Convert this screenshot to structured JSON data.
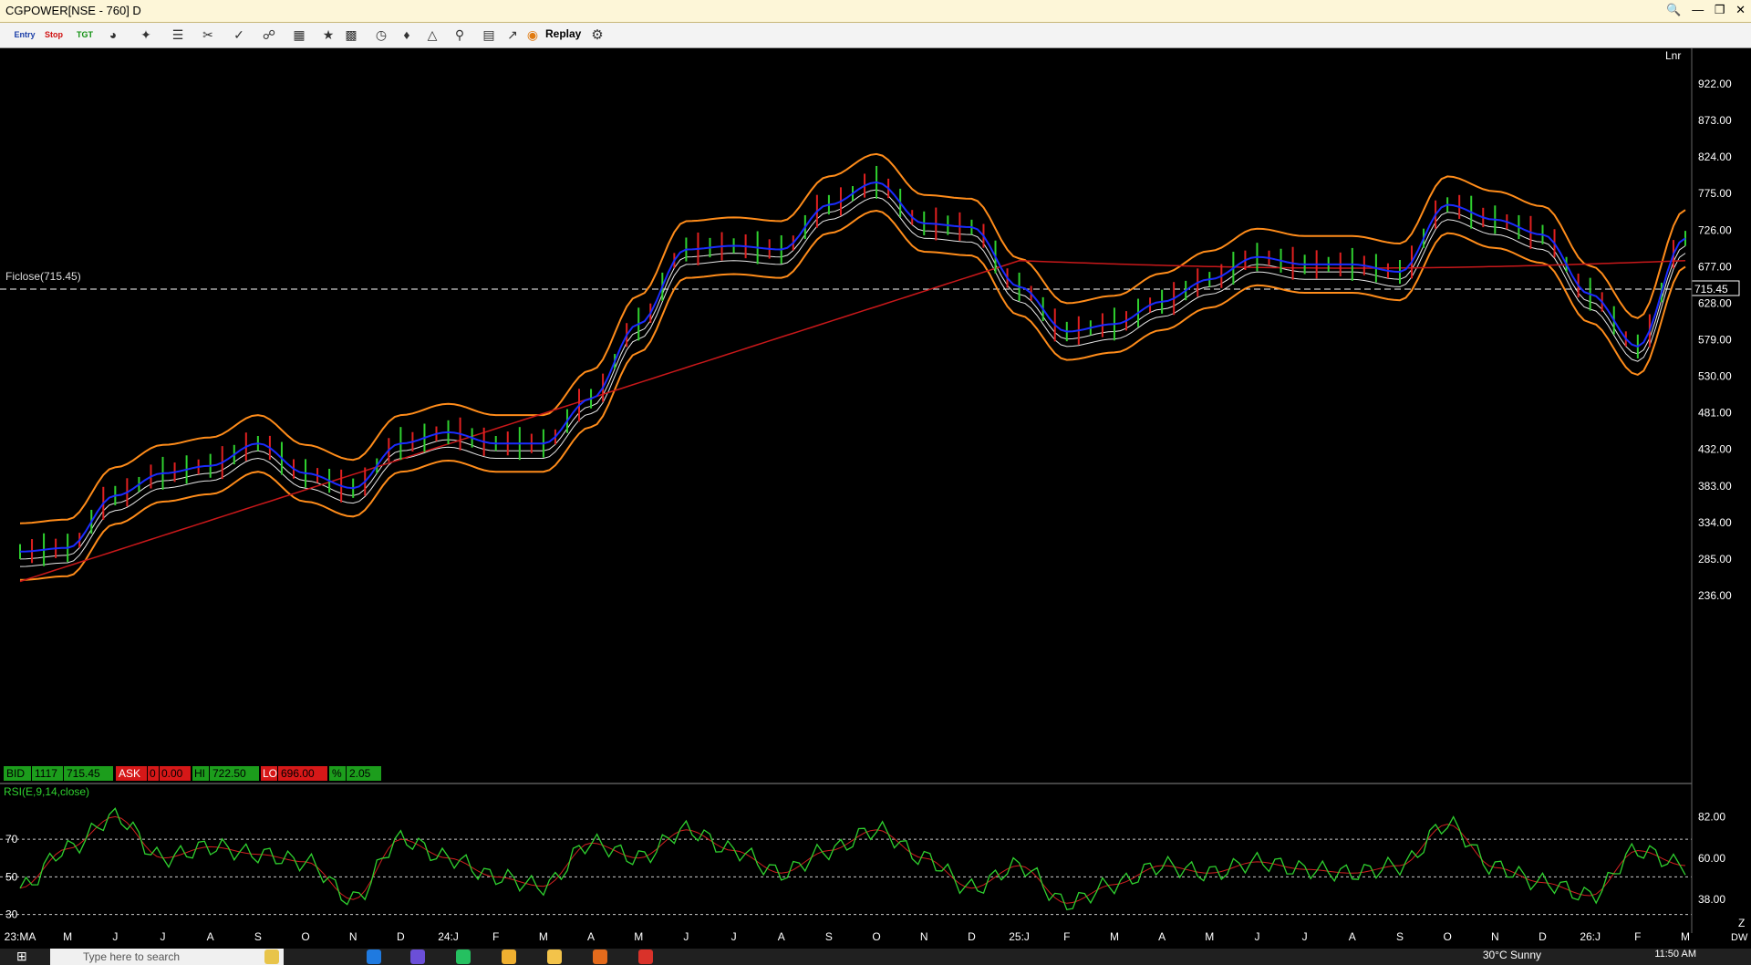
{
  "window": {
    "title": "CGPOWER[NSE - 760] D"
  },
  "toolbar": {
    "entry": "Entry",
    "stop": "Stop",
    "tgt": "TGT",
    "replay": "Replay"
  },
  "chart": {
    "scale_mode": "Lnr",
    "cursor_label": "Ficlose(715.45)",
    "last_price_tag": "715.45",
    "price_ticks": [
      "922.00",
      "873.00",
      "824.00",
      "775.00",
      "726.00",
      "677.00",
      "628.00",
      "579.00",
      "530.00",
      "481.00",
      "432.00",
      "383.00",
      "334.00",
      "285.00",
      "236.00"
    ],
    "quote_bar": {
      "bid_label": "BID",
      "bid_qty": "1117",
      "bid_price": "715.45",
      "ask_label": "ASK",
      "ask_qty": "0",
      "ask_price": "0.00",
      "hi_label": "HI",
      "hi": "722.50",
      "lo_label": "LO",
      "lo": "696.00",
      "pct_label": "%",
      "pct": "2.05"
    },
    "rsi": {
      "label": "RSI(E,9,14,close)",
      "left_levels": [
        "70",
        "50",
        "30"
      ],
      "right_ticks": [
        "82.00",
        "60.00",
        "38.00"
      ]
    },
    "x_axis": [
      "23:MA",
      "M",
      "J",
      "J",
      "A",
      "S",
      "O",
      "N",
      "D",
      "24:J",
      "F",
      "M",
      "A",
      "M",
      "J",
      "J",
      "A",
      "S",
      "O",
      "N",
      "D",
      "25:J",
      "F",
      "M",
      "A",
      "M",
      "J",
      "J",
      "A",
      "S",
      "O",
      "N",
      "D",
      "26:J",
      "F",
      "M"
    ],
    "corner_labels": {
      "z": "Z",
      "dw": "DW"
    },
    "colors": {
      "price_line": "#1a2cff",
      "bands": "#ff8c1a",
      "ma_white": "#e8e8e8",
      "long_ma": "#c8181a",
      "rsi_line": "#2fd12f",
      "rsi_signal": "#d02020",
      "quote_green": "#1c9d1c",
      "quote_red": "#d61818"
    }
  },
  "chart_data": {
    "type": "line",
    "title": "CGPOWER[NSE - 760] D",
    "categories": [
      "23:MA",
      "M",
      "J",
      "J",
      "A",
      "S",
      "O",
      "N",
      "D",
      "24:J",
      "F",
      "M",
      "A",
      "M",
      "J",
      "J",
      "A",
      "S",
      "O",
      "N",
      "D",
      "25:J",
      "F",
      "M",
      "A",
      "M",
      "J",
      "J",
      "A",
      "S",
      "O",
      "N",
      "D",
      "26:J",
      "F",
      "M"
    ],
    "series": [
      {
        "values": [
          295,
          300,
          370,
          400,
          410,
          440,
          400,
          380,
          440,
          455,
          440,
          440,
          500,
          600,
          700,
          705,
          700,
          760,
          790,
          735,
          730,
          650,
          590,
          600,
          630,
          660,
          690,
          680,
          680,
          670,
          760,
          740,
          720,
          640,
          570,
          715
        ]
      }
    ],
    "ylim": [
      236,
      922
    ],
    "rsi_values": [
      44,
      65,
      82,
      60,
      66,
      62,
      58,
      38,
      70,
      60,
      50,
      45,
      68,
      60,
      75,
      64,
      52,
      64,
      75,
      60,
      44,
      56,
      36,
      46,
      56,
      52,
      58,
      54,
      52,
      56,
      78,
      55,
      47,
      40,
      64,
      56
    ]
  },
  "taskbar": {
    "search": "Type here to search",
    "weather": "30°C  Sunny",
    "clock": "11:50 AM"
  }
}
